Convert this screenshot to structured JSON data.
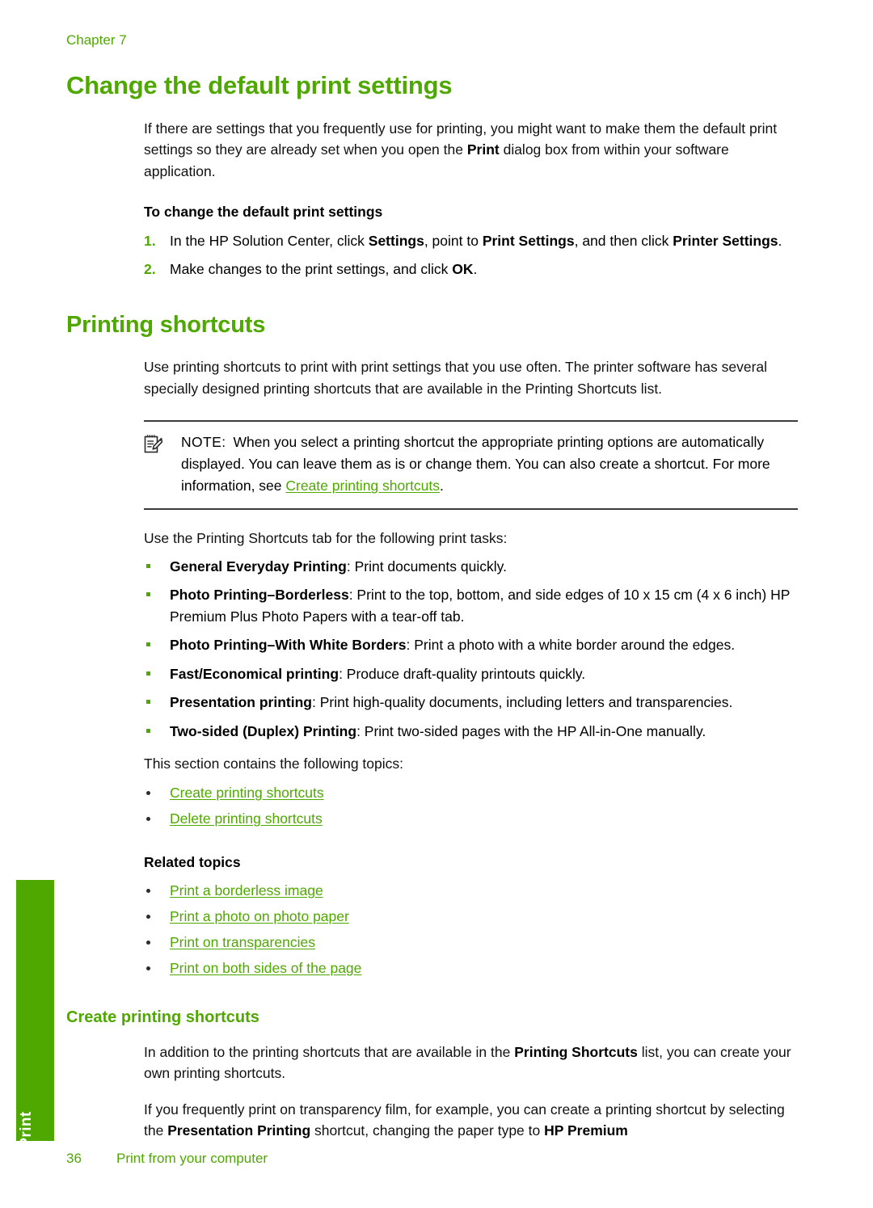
{
  "meta": {
    "chapter_label": "Chapter 7",
    "accent_green": "#4fa800",
    "text_black": "#111111"
  },
  "side_tab": {
    "label": "Print"
  },
  "sections": {
    "change_defaults": {
      "heading": "Change the default print settings",
      "intro": {
        "part1": "If there are settings that you frequently use for printing, you might want to make them the default print settings so they are already set when you open the ",
        "bold1": "Print",
        "part2": " dialog box from within your software application."
      },
      "procedure_title": "To change the default print settings",
      "steps": [
        {
          "num": "1.",
          "part1": "In the HP Solution Center, click ",
          "bold1": "Settings",
          "part2": ", point to ",
          "bold2": "Print Settings",
          "part3": ", and then click ",
          "bold3": "Printer Settings",
          "part4": "."
        },
        {
          "num": "2.",
          "part1": "Make changes to the print settings, and click ",
          "bold1": "OK",
          "part2": "."
        }
      ]
    },
    "printing_shortcuts": {
      "heading": "Printing shortcuts",
      "intro": "Use printing shortcuts to print with print settings that you use often. The printer software has several specially designed printing shortcuts that are available in the Printing Shortcuts list.",
      "note": {
        "icon": "note-pencil-icon",
        "label": "NOTE:",
        "part1": "When you select a printing shortcut the appropriate printing options are automatically displayed. You can leave them as is or change them. You can also create a shortcut. For more information, see ",
        "link": "Create printing shortcuts",
        "part2": "."
      },
      "tasks_intro": "Use the Printing Shortcuts tab for the following print tasks:",
      "tasks": [
        {
          "bold": "General Everyday Printing",
          "rest": ": Print documents quickly."
        },
        {
          "bold": "Photo Printing–Borderless",
          "rest": ": Print to the top, bottom, and side edges of 10 x 15 cm (4 x 6 inch) HP Premium Plus Photo Papers with a tear-off tab."
        },
        {
          "bold": "Photo Printing–With White Borders",
          "rest": ": Print a photo with a white border around the edges."
        },
        {
          "bold": "Fast/Economical printing",
          "rest": ": Produce draft-quality printouts quickly."
        },
        {
          "bold": "Presentation printing",
          "rest": ": Print high-quality documents, including letters and transparencies."
        },
        {
          "bold": "Two-sided (Duplex) Printing",
          "rest": ": Print two-sided pages with the HP All-in-One manually."
        }
      ],
      "topics_intro": "This section contains the following topics:",
      "topics": [
        "Create printing shortcuts",
        "Delete printing shortcuts"
      ],
      "related_title": "Related topics",
      "related": [
        "Print a borderless image",
        "Print a photo on photo paper",
        "Print on transparencies",
        "Print on both sides of the page"
      ]
    },
    "create_shortcuts": {
      "heading": "Create printing shortcuts",
      "para1": {
        "part1": "In addition to the printing shortcuts that are available in the ",
        "bold1": "Printing Shortcuts",
        "part2": " list, you can create your own printing shortcuts."
      },
      "para2": {
        "part1": "If you frequently print on transparency film, for example, you can create a printing shortcut by selecting the ",
        "bold1": "Presentation Printing",
        "part2": " shortcut, changing the paper type to ",
        "bold2": "HP Premium"
      }
    }
  },
  "footer": {
    "page_number": "36",
    "text": "Print from your computer"
  }
}
